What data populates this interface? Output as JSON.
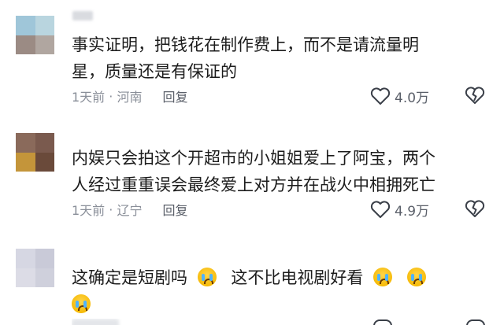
{
  "comments": [
    {
      "text_line1": "事实证明，把钱花在制作费上，而不是请流量明",
      "text_line2": "星，质量还是有保证的",
      "time": "1天前",
      "location": "河南",
      "reply_label": "回复",
      "likes": "4.0万",
      "avatar_colors": [
        "#9fc6d9",
        "#b9d5df",
        "#9b8b84",
        "#b0a6a0"
      ]
    },
    {
      "text_line1": "内娱只会拍这个开超市的小姐姐爱上了阿宝，两个",
      "text_line2": "人经过重重误会最终爱上对方并在战火中相拥死亡",
      "time": "1天前",
      "location": "辽宁",
      "reply_label": "回复",
      "likes": "4.9万",
      "avatar_colors": [
        "#8a6a5b",
        "#7a5a4e",
        "#c4953a",
        "#6a4a3a"
      ]
    },
    {
      "text_line1": "这确定是短剧吗",
      "text_line1b": "这不比电视剧好看",
      "avatar_colors": [
        "#d6d7e3",
        "#c9cad8",
        "#dcdce6",
        "#cfd0dc"
      ]
    }
  ],
  "icons": {
    "like": "heart-outline-icon",
    "dislike": "broken-heart-icon",
    "emoji": "crying-face-emoji"
  }
}
